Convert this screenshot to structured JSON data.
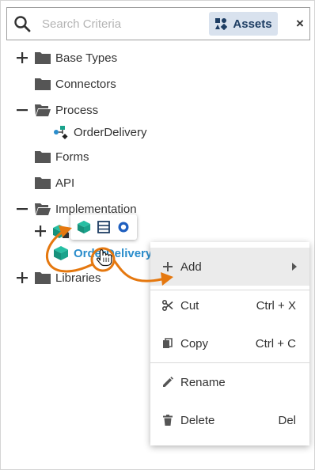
{
  "search": {
    "placeholder": "Search Criteria",
    "assets_label": "Assets",
    "close_glyph": "×"
  },
  "tree": {
    "items": [
      {
        "label": "Base Types",
        "expander": "plus",
        "icon": "folder-icon"
      },
      {
        "label": "Connectors",
        "expander": "none",
        "icon": "folder-icon"
      },
      {
        "label": "Process",
        "expander": "minus",
        "icon": "folder-open-icon"
      },
      {
        "label": "OrderDelivery",
        "expander": "none",
        "icon": "process-flow-icon"
      },
      {
        "label": "Forms",
        "expander": "none",
        "icon": "folder-icon"
      },
      {
        "label": "API",
        "expander": "none",
        "icon": "folder-icon"
      },
      {
        "label": "Implementation",
        "expander": "minus",
        "icon": "folder-open-icon"
      },
      {
        "label": "",
        "expander": "plus",
        "icon": "locked-package-icon"
      },
      {
        "label": "OrderDelivery",
        "expander": "none",
        "icon": "package-icon",
        "selected": true
      },
      {
        "label": "Libraries",
        "expander": "plus",
        "icon": "folder-icon"
      }
    ]
  },
  "mini_toolbar": {
    "buttons": [
      "package-icon",
      "table-icon",
      "circle-target-icon"
    ]
  },
  "context_menu": {
    "items": [
      {
        "label": "Add",
        "shortcut": "",
        "icon": "plus-icon",
        "submenu": true
      },
      {
        "label": "Cut",
        "shortcut": "Ctrl + X",
        "icon": "scissors-icon"
      },
      {
        "label": "Copy",
        "shortcut": "Ctrl + C",
        "icon": "copy-icon"
      },
      {
        "label": "Rename",
        "shortcut": "",
        "icon": "pencil-icon"
      },
      {
        "label": "Delete",
        "shortcut": "Del",
        "icon": "trash-icon"
      }
    ]
  },
  "colors": {
    "accent": "#2a8dcc",
    "annotation": "#e5780f",
    "assets_bg": "#d9e2ee",
    "assets_text": "#1d3d63",
    "package": "#1aa38c"
  }
}
